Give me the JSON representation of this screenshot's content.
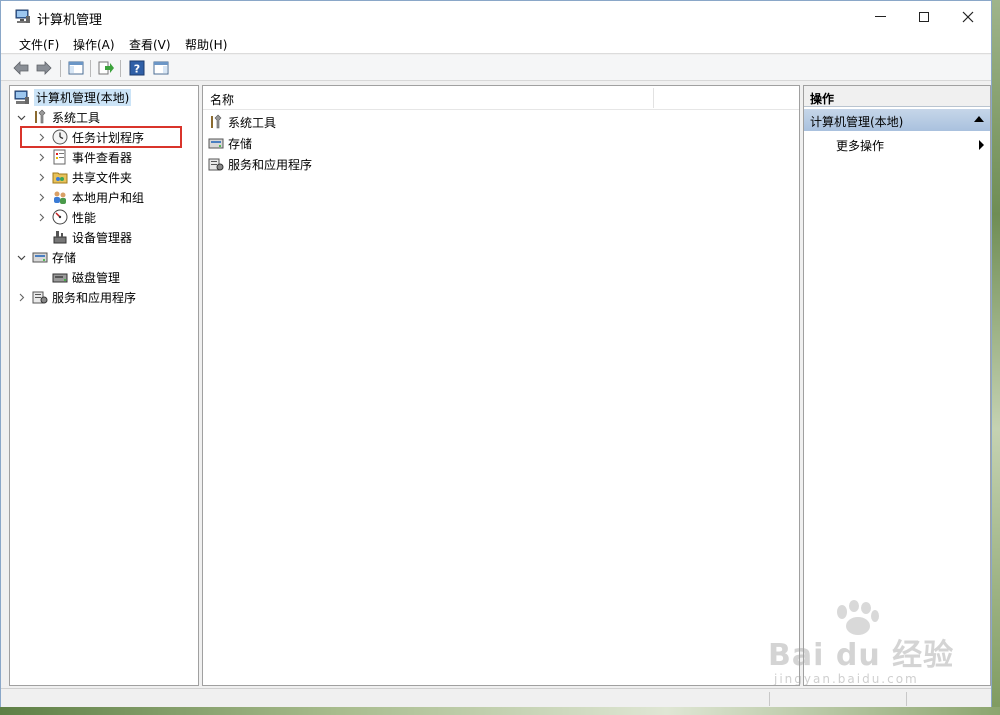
{
  "window": {
    "title": "计算机管理"
  },
  "menubar": {
    "items": [
      "文件(F)",
      "操作(A)",
      "查看(V)",
      "帮助(H)"
    ]
  },
  "tree": {
    "root": "计算机管理(本地)",
    "system_tools": "系统工具",
    "task_scheduler": "任务计划程序",
    "event_viewer": "事件查看器",
    "shared_folders": "共享文件夹",
    "local_users_groups": "本地用户和组",
    "performance": "性能",
    "device_manager": "设备管理器",
    "storage": "存储",
    "disk_management": "磁盘管理",
    "services_apps": "服务和应用程序"
  },
  "center": {
    "column_name": "名称",
    "items": [
      "系统工具",
      "存储",
      "服务和应用程序"
    ]
  },
  "actions": {
    "title": "操作",
    "section": "计算机管理(本地)",
    "more": "更多操作"
  },
  "watermark": {
    "brand": "Bai du 经验",
    "url": "jingyan.baidu.com"
  },
  "colors": {
    "highlight_box": "#d9342b",
    "selection": "#cce4f7",
    "action_header": "#b6cbe3"
  }
}
